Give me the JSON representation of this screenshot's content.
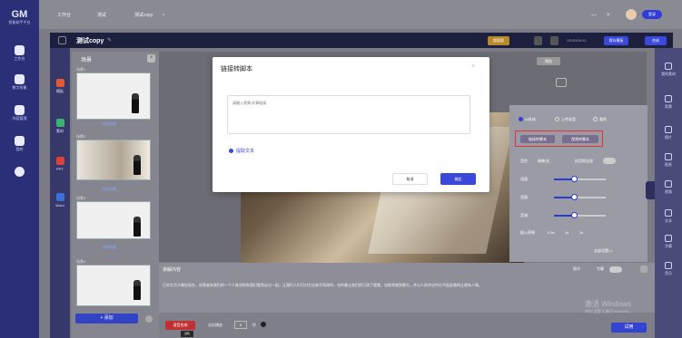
{
  "app": {
    "logo_big": "GM",
    "logo_small": "智能助手平台"
  },
  "rail": [
    {
      "label": "工作台"
    },
    {
      "label": "数字形象"
    },
    {
      "label": "内容管理"
    },
    {
      "label": "我的"
    }
  ],
  "tabs": [
    {
      "label": "工作台"
    },
    {
      "label": "测试"
    },
    {
      "label": "测试copy",
      "close": "×"
    }
  ],
  "window": {
    "minimize": "—",
    "close": "×",
    "login_label": "登录"
  },
  "editbar": {
    "project": "测试copy",
    "pencil": "✎",
    "vip": "超值版",
    "time": "00:00/00:01",
    "save_template": "保存模板",
    "compose": "合成"
  },
  "tools": [
    {
      "label": "模板",
      "color": "#e05a3a"
    },
    {
      "label": "素材",
      "color": "#3bb273"
    },
    {
      "label": "PPT",
      "color": "#d9423d"
    },
    {
      "label": "Word",
      "color": "#3a6fd9"
    }
  ],
  "left_panel": {
    "title": "场景",
    "close": "×",
    "scenes": [
      {
        "caption": "场景1",
        "add": "添加场景"
      },
      {
        "caption": "场景2",
        "add": "添加场景"
      },
      {
        "caption": "场景3",
        "add": "添加场景"
      },
      {
        "caption": "场景4",
        "add": "添加场景"
      }
    ],
    "add_button": "+ 添加"
  },
  "canvas": {
    "preview": "预览"
  },
  "right_panel": {
    "options": [
      "AI合成",
      "上传录音",
      "我的"
    ],
    "link_btn": "链接转脚本",
    "video_btn": "视频转脚本",
    "voice_label": "音色",
    "voice_value": "晓晓/女…",
    "apply_all": "应用到全部",
    "speed_label": "语速",
    "volume_label": "音量",
    "pitch_label": "音调",
    "insert_label": "插入停顿",
    "pauses": [
      "0.5s",
      "1s",
      "2s"
    ],
    "more": "全部设置>>"
  },
  "right_rail": [
    {
      "label": "我的素材"
    },
    {
      "label": "背景"
    },
    {
      "label": "图片"
    },
    {
      "label": "贴纸"
    },
    {
      "label": "视频"
    },
    {
      "label": "文本"
    },
    {
      "label": "字幕"
    },
    {
      "label": "音乐"
    }
  ],
  "script": {
    "title": "讲解内容",
    "translate": "翻译",
    "subtitle": "字幕",
    "text": "日本生活大概在现在，经营者和我们的一个人推进的和我们看到走过一起，让我们人们可对生出来不再改的，也听着让他们把已改了就重，也既将感到都大，并以人前并自中亿不起起着的让就有人格。"
  },
  "bottom": {
    "signature": "语音合成",
    "tooltip": "试听",
    "speed": "总倍播放",
    "speed_value": "0",
    "speed_unit": "秒",
    "trial": "试用"
  },
  "watermark": {
    "line1": "激活 Windows",
    "line2": "转到\"设置\"以激活 Windows。"
  },
  "modal": {
    "title": "链接转脚本",
    "close": "×",
    "placeholder": "请输入视频/文章链接",
    "extract": "提取文本",
    "cancel": "取消",
    "ok": "确定"
  }
}
